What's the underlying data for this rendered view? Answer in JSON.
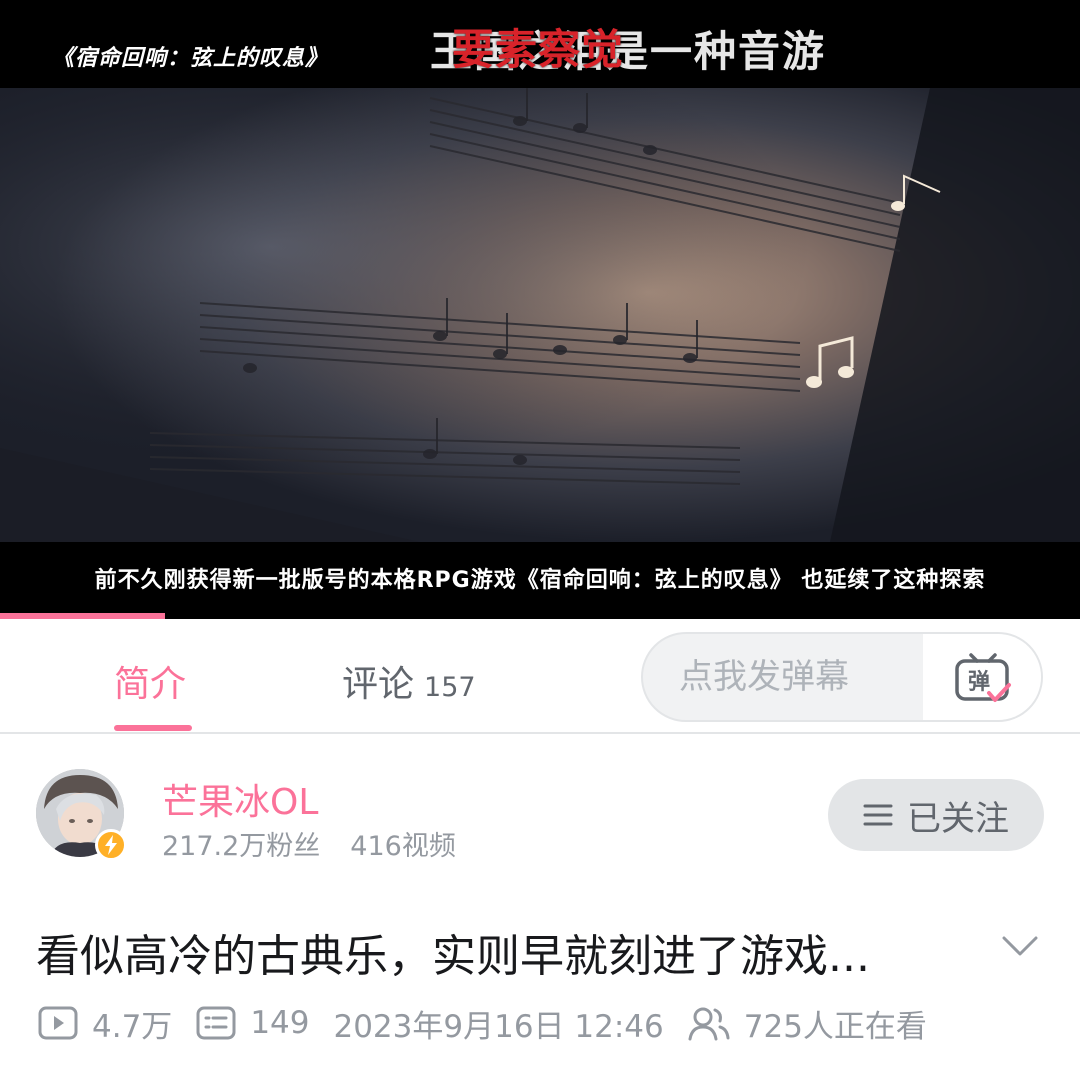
{
  "player": {
    "video_label": "《宿命回响：弦上的叹息》",
    "caption_top_under": "王国之泪是一种音游",
    "caption_top_over": "要素察觉",
    "subtitle": "前不久刚获得新一批版号的本格RPG游戏《宿命回响：弦上的叹息》 也延续了这种探索",
    "progress_percent": 15.3,
    "accent": "#fb7299"
  },
  "tabs": {
    "intro_label": "简介",
    "comments_label": "评论",
    "comments_count": "157",
    "danmaku_placeholder": "点我发弹幕",
    "danmaku_icon_text": "弹"
  },
  "uploader": {
    "name": "芒果冰OL",
    "followers": "217.2万粉丝",
    "videos": "416视频",
    "follow_label": "已关注"
  },
  "video": {
    "title": "看似高冷的古典乐，实则早就刻进了游戏...",
    "views": "4.7万",
    "danmaku_count": "149",
    "publish_time": "2023年9月16日 12:46",
    "watching_now": "725人正在看"
  },
  "icons": {
    "danmaku_send": "danmaku-tv-icon",
    "follow_menu": "menu-lines-icon",
    "expand": "chevron-down-icon",
    "views": "play-icon",
    "danmaku": "danmaku-list-icon",
    "watching": "people-icon"
  }
}
